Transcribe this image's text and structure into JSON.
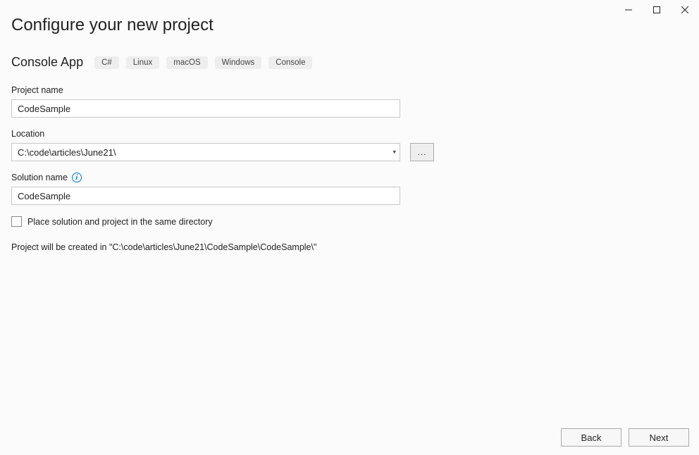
{
  "window": {
    "minimize": "–",
    "maximize": "☐",
    "close": "✕"
  },
  "title": "Configure your new project",
  "template": {
    "name": "Console App",
    "tags": [
      "C#",
      "Linux",
      "macOS",
      "Windows",
      "Console"
    ]
  },
  "fields": {
    "project_name": {
      "label": "Project name",
      "value": "CodeSample"
    },
    "location": {
      "label": "Location",
      "value": "C:\\code\\articles\\June21\\",
      "browse": "..."
    },
    "solution_name": {
      "label": "Solution name",
      "value": "CodeSample"
    },
    "same_dir": {
      "label": "Place solution and project in the same directory",
      "checked": false
    }
  },
  "summary": "Project will be created in \"C:\\code\\articles\\June21\\CodeSample\\CodeSample\\\"",
  "buttons": {
    "back": "Back",
    "next": "Next"
  }
}
